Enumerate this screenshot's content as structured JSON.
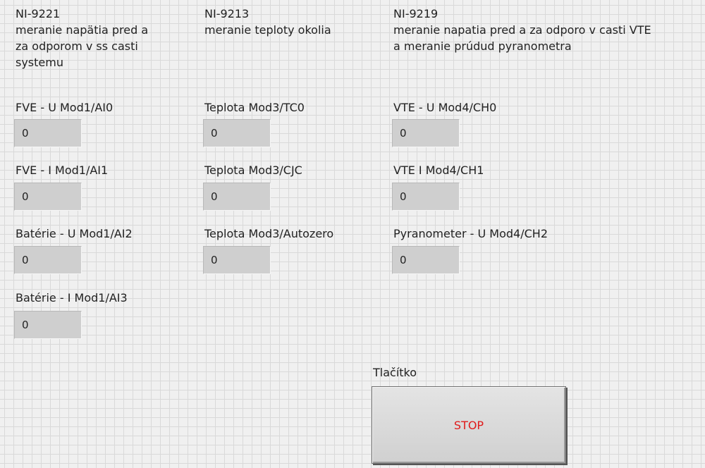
{
  "modules": {
    "ni9221": {
      "title": "NI-9221\nmeranie napätia pred a\nza odporom v ss casti\nsystemu"
    },
    "ni9213": {
      "title": "NI-9213\nmeranie teploty okolia"
    },
    "ni9219": {
      "title": "NI-9219\nmeranie napatia pred a za odporo v casti VTE\na meranie prúdud pyranometra"
    }
  },
  "indicators": {
    "fve_u": {
      "label": "FVE - U Mod1/AI0",
      "value": "0"
    },
    "fve_i": {
      "label": "FVE - I Mod1/AI1",
      "value": "0"
    },
    "bat_u": {
      "label": "Batérie - U Mod1/AI2",
      "value": "0"
    },
    "bat_i": {
      "label": "Batérie - I Mod1/AI3",
      "value": "0"
    },
    "temp_tc0": {
      "label": "Teplota Mod3/TC0",
      "value": "0"
    },
    "temp_cjc": {
      "label": "Teplota Mod3/CJC",
      "value": "0"
    },
    "temp_autozero": {
      "label": "Teplota Mod3/Autozero",
      "value": "0"
    },
    "vte_u": {
      "label": "VTE - U Mod4/CH0",
      "value": "0"
    },
    "vte_i": {
      "label": "VTE I Mod4/CH1",
      "value": "0"
    },
    "pyranometer_u": {
      "label": "Pyranometer - U Mod4/CH2",
      "value": "0"
    }
  },
  "stop": {
    "label": "Tlačítko",
    "text": "STOP",
    "text_color": "#e01b1b"
  }
}
